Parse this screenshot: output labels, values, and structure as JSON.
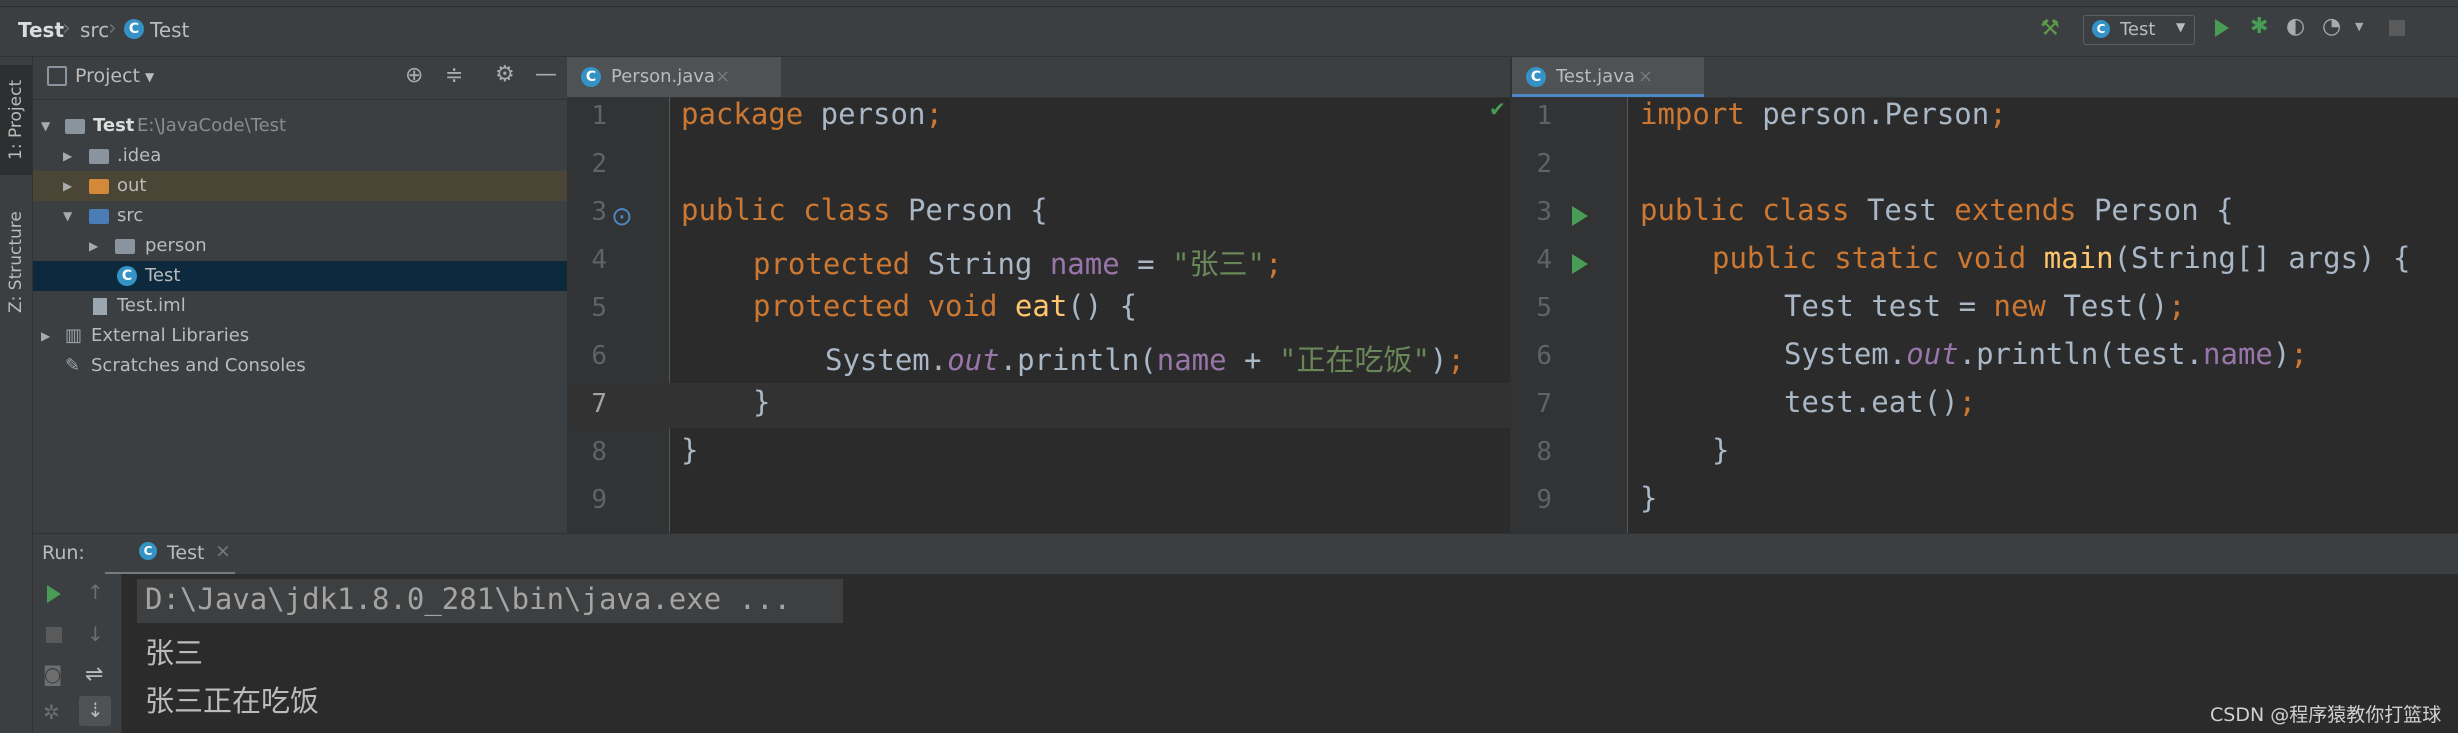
{
  "breadcrumb": [
    "Test",
    "src",
    "Test"
  ],
  "run_config": "Test",
  "left_strip": {
    "project_tab": "1: Project",
    "structure_tab": "Z: Structure"
  },
  "project_panel": {
    "title": "Project",
    "tree": [
      {
        "label": "Test",
        "path": "E:\\JavaCode\\Test"
      },
      {
        "label": ".idea"
      },
      {
        "label": "out"
      },
      {
        "label": "src"
      },
      {
        "label": "person"
      },
      {
        "label": "Test"
      },
      {
        "label": "Test.iml"
      },
      {
        "label": "External Libraries"
      },
      {
        "label": "Scratches and Consoles"
      }
    ]
  },
  "editor_left": {
    "tab": "Person.java",
    "line_numbers": [
      "1",
      "2",
      "3",
      "4",
      "5",
      "6",
      "7",
      "8",
      "9"
    ],
    "lines": [
      {
        "kw1": "package",
        "rest": " person",
        "end": ";"
      },
      {},
      {
        "kw1": "public class",
        "name": " Person {"
      },
      {
        "kw1": "protected",
        "type": " String ",
        "field": "name",
        "op": " = ",
        "str": "\"张三\"",
        "end": ";"
      },
      {
        "kw1": "protected void",
        "meth": " eat",
        "rest": "() {"
      },
      {
        "pre": "System.",
        "static": "out",
        "mid": ".println(",
        "field": "name",
        "op": " + ",
        "str": "\"正在吃饭\"",
        "rest": ")",
        "end": ";"
      },
      {
        "rest": "}"
      },
      {
        "rest": "}"
      },
      {}
    ]
  },
  "editor_right": {
    "tab": "Test.java",
    "line_numbers": [
      "1",
      "2",
      "3",
      "4",
      "5",
      "6",
      "7",
      "8",
      "9"
    ],
    "lines": [
      {
        "kw1": "import",
        "rest": " person.Person",
        "end": ";"
      },
      {},
      {
        "kw1": "public class",
        "name": " Test ",
        "kw2": "extends",
        "rest": " Person {"
      },
      {
        "kw1": "public static void",
        "meth": " main",
        "rest": "(String[] args) {"
      },
      {
        "pre": "Test test = ",
        "kw1": "new",
        "rest": " Test()",
        "end": ";"
      },
      {
        "pre": "System.",
        "static": "out",
        "mid": ".println(test.",
        "field": "name",
        "rest": ")",
        "end": ";"
      },
      {
        "pre": "test.eat()",
        "end": ";"
      },
      {
        "rest": "}"
      },
      {
        "rest": "}"
      }
    ]
  },
  "run_panel": {
    "label": "Run:",
    "tab": "Test",
    "output": [
      "D:\\Java\\jdk1.8.0_281\\bin\\java.exe ...",
      "张三",
      "张三正在吃饭"
    ]
  },
  "watermark": "CSDN @程序猿教你打篮球",
  "colors": {
    "keyword": "#cc7832",
    "string": "#6a8759",
    "field": "#9876aa",
    "method": "#ffc66d",
    "text": "#a9b7c6"
  }
}
